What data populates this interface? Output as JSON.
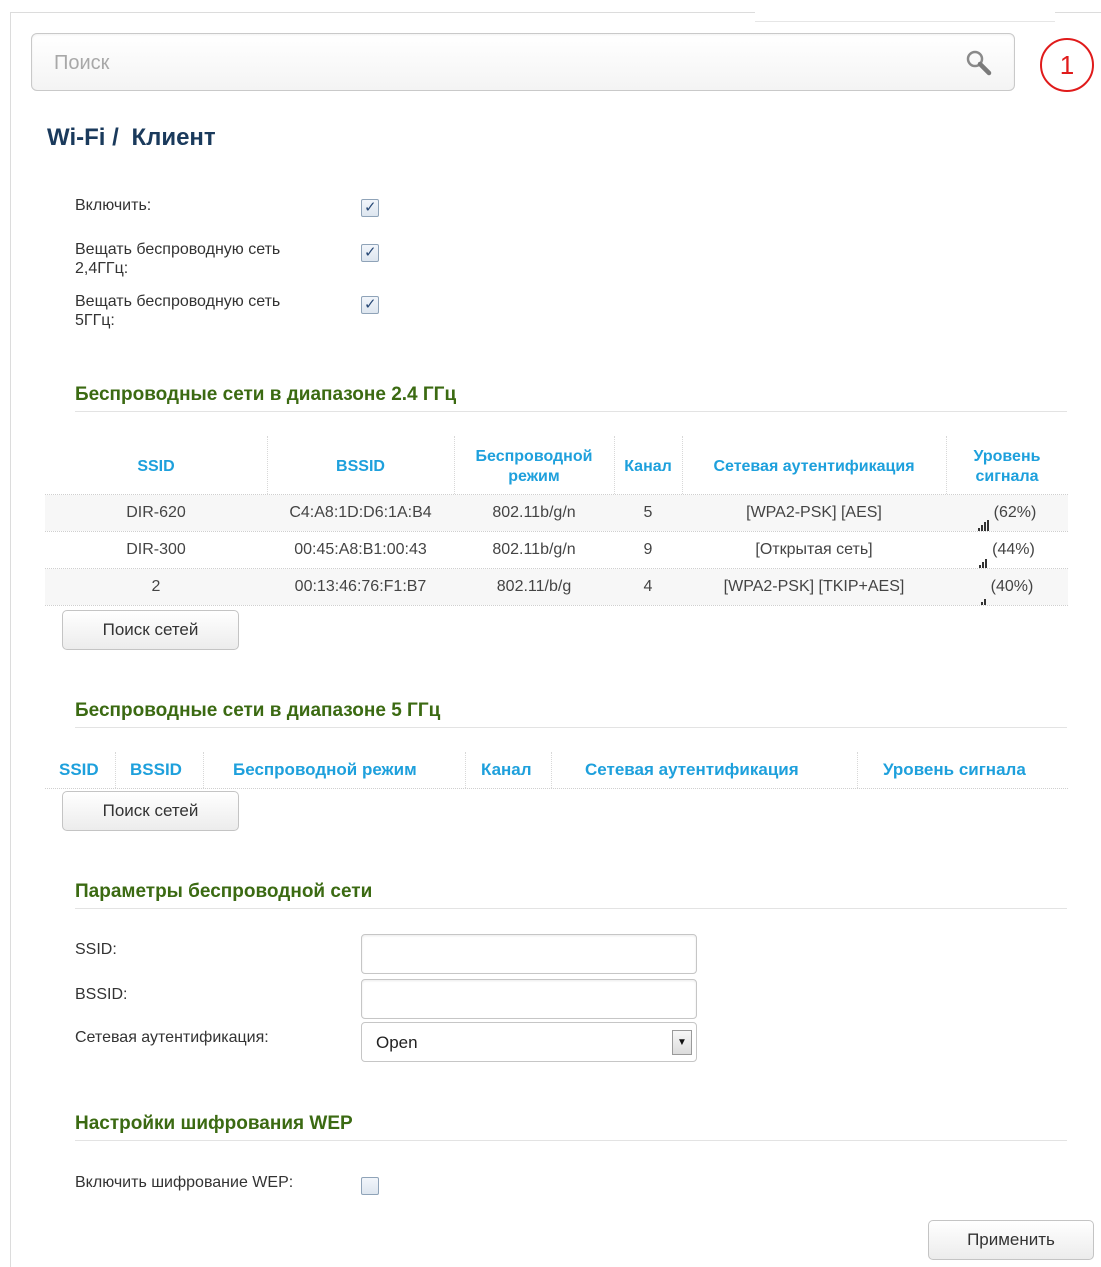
{
  "search": {
    "placeholder": "Поиск"
  },
  "notification_count": "1",
  "breadcrumb": {
    "section": "Wi-Fi /",
    "page": "Клиент"
  },
  "toggles": [
    {
      "label": "Включить:",
      "checked": true
    },
    {
      "label_line1": "Вещать беспроводную сеть",
      "label_line2": "2,4ГГц:",
      "checked": true
    },
    {
      "label_line1": "Вещать беспроводную сеть",
      "label_line2": "5ГГц:",
      "checked": true
    }
  ],
  "section_24": {
    "title": "Беспроводные сети в диапазоне 2.4 ГГц",
    "headers": [
      "SSID",
      "BSSID",
      "Беспроводной режим",
      "Канал",
      "Сетевая аутентификация",
      "Уровень сигнала"
    ],
    "rows": [
      {
        "ssid": "DIR-620",
        "bssid": "C4:A8:1D:D6:1A:B4",
        "mode": "802.11b/g/n",
        "channel": "5",
        "auth": "[WPA2-PSK] [AES]",
        "signal": "(62%)",
        "bars": 3
      },
      {
        "ssid": "DIR-300",
        "bssid": "00:45:A8:B1:00:43",
        "mode": "802.11b/g/n",
        "channel": "9",
        "auth": "[Открытая сеть]",
        "signal": "(44%)",
        "bars": 2
      },
      {
        "ssid": "2",
        "bssid": "00:13:46:76:F1:B7",
        "mode": "802.11/b/g",
        "channel": "4",
        "auth": "[WPA2-PSK] [TKIP+AES]",
        "signal": "(40%)",
        "bars": 1
      }
    ],
    "scan_button": "Поиск сетей"
  },
  "section_5": {
    "title": "Беспроводные сети в диапазоне 5 ГГц",
    "headers": [
      "SSID",
      "BSSID",
      "Беспроводной режим",
      "Канал",
      "Сетевая аутентификация",
      "Уровень сигнала"
    ],
    "scan_button": "Поиск сетей"
  },
  "params": {
    "title": "Параметры беспроводной сети",
    "ssid_label": "SSID:",
    "ssid_value": "",
    "bssid_label": "BSSID:",
    "bssid_value": "",
    "auth_label": "Сетевая аутентификация:",
    "auth_value": "Open"
  },
  "wep": {
    "title": "Настройки шифрования WEP",
    "enable_label": "Включить шифрование WEP:",
    "enabled": false
  },
  "apply_button": "Применить"
}
